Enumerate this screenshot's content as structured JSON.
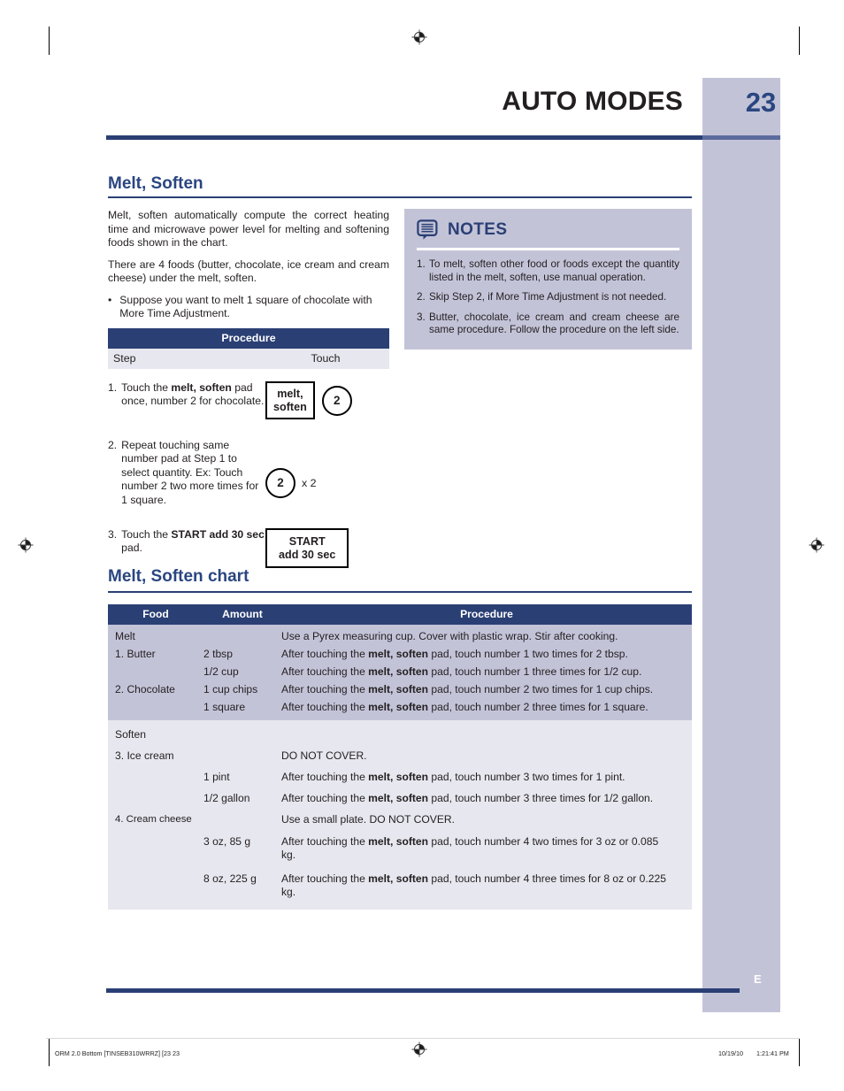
{
  "page": {
    "header_title": "AUTO MODES",
    "page_number": "23",
    "lang_marker": "E"
  },
  "section1": {
    "heading": "Melt, Soften",
    "paragraphs": [
      "Melt, soften automatically compute the correct heating time and microwave power level for melting and  softening foods shown in the chart.",
      "There are 4 foods (butter, chocolate, ice cream and cream cheese) under the melt, soften."
    ],
    "bullet": {
      "marker": "•",
      "text": "Suppose you want to melt 1 square of chocolate with More Time Adjustment."
    }
  },
  "procedure_table": {
    "title": "Procedure",
    "subheader": {
      "step": "Step",
      "touch": "Touch"
    },
    "steps": [
      {
        "number": "1.",
        "text_parts": [
          "Touch the ",
          "melt, soften",
          " pad once, number 2 for chocolate."
        ],
        "pad_label_line1": "melt,",
        "pad_label_line2": "soften",
        "circle": "2"
      },
      {
        "number": "2.",
        "text_parts": [
          "Repeat touching same number pad at Step 1 to select quantity.",
          "",
          " Ex: Touch number 2 two more times for 1 square."
        ],
        "circle": "2",
        "multiplier": "x 2"
      },
      {
        "number": "3.",
        "text_parts": [
          "Touch the ",
          "START add 30 sec",
          " pad."
        ],
        "pad_label_line1": "START",
        "pad_label_line2": "add 30 sec"
      }
    ]
  },
  "notes": {
    "icon": "notes-bubble-icon",
    "title": "NOTES",
    "items": [
      {
        "number": "1.",
        "text": "To melt, soften other food or foods except the quantity listed in the melt, soften, use manual operation."
      },
      {
        "number": "2.",
        "text": "Skip Step 2, if More Time Adjustment is not needed."
      },
      {
        "number": "3.",
        "text": "Butter, chocolate, ice cream and cream cheese are same procedure. Follow the procedure on the left side."
      }
    ]
  },
  "section2": {
    "heading": "Melt, Soften chart"
  },
  "chart_table": {
    "columns": [
      "Food",
      "Amount",
      "Procedure"
    ],
    "groups": [
      {
        "name": "melt",
        "rows": [
          {
            "food": "Melt",
            "amount": "",
            "proc_pre": "Use a Pyrex measuring cup. Cover with plastic wrap. Stir after cooking.",
            "proc_bold": "",
            "proc_post": ""
          },
          {
            "food": "1.  Butter",
            "amount": "2 tbsp",
            "proc_pre": "After touching the ",
            "proc_bold": "melt, soften",
            "proc_post": " pad, touch number 1 two times for 2 tbsp."
          },
          {
            "food": "",
            "amount": "1/2 cup",
            "proc_pre": "After touching the ",
            "proc_bold": "melt, soften",
            "proc_post": " pad, touch number 1 three times for 1/2 cup."
          },
          {
            "food": "2.  Chocolate",
            "amount": "1 cup chips",
            "proc_pre": "After touching the ",
            "proc_bold": "melt, soften",
            "proc_post": " pad, touch number 2 two times for 1 cup chips."
          },
          {
            "food": "",
            "amount": "1 square",
            "proc_pre": "After touching the ",
            "proc_bold": "melt, soften",
            "proc_post": " pad, touch number 2 three times for 1 square."
          }
        ]
      },
      {
        "name": "soften",
        "rows": [
          {
            "food": "Soften",
            "amount": "",
            "proc_pre": "",
            "proc_bold": "",
            "proc_post": ""
          },
          {
            "food": "3.  Ice cream",
            "amount": "",
            "proc_pre": "DO NOT COVER.",
            "proc_bold": "",
            "proc_post": ""
          },
          {
            "food": "",
            "amount": "1 pint",
            "proc_pre": "After touching the ",
            "proc_bold": "melt, soften",
            "proc_post": " pad, touch number 3 two times for 1 pint."
          },
          {
            "food": "",
            "amount": "1/2 gallon",
            "proc_pre": "After touching the ",
            "proc_bold": "melt, soften",
            "proc_post": " pad, touch number 3 three times for 1/2 gallon."
          },
          {
            "food": "4.  Cream cheese",
            "amount": "",
            "proc_pre": "Use a small plate. DO NOT COVER.",
            "proc_bold": "",
            "proc_post": ""
          },
          {
            "food": "",
            "amount": "3 oz, 85 g",
            "proc_pre": "After touching the ",
            "proc_bold": "melt, soften",
            "proc_post": " pad, touch number 4 two times for 3 oz or 0.085 kg."
          },
          {
            "food": "",
            "amount": "8 oz, 225 g",
            "proc_pre": "After touching the ",
            "proc_bold": "melt, soften",
            "proc_post": " pad, touch number 4 three times for 8 oz or 0.225 kg."
          }
        ]
      }
    ]
  },
  "footer": {
    "left": "ORM 2.0 Bottom [TINSEB310WRRZ] [23   23",
    "right_date": "10/19/10",
    "right_time": "1:21:41 PM"
  },
  "colors": {
    "navy": "#2a3f74",
    "heading_blue": "#2a4680",
    "band_lavender": "#c3c3d8",
    "row_light": "#e7e7ef"
  }
}
